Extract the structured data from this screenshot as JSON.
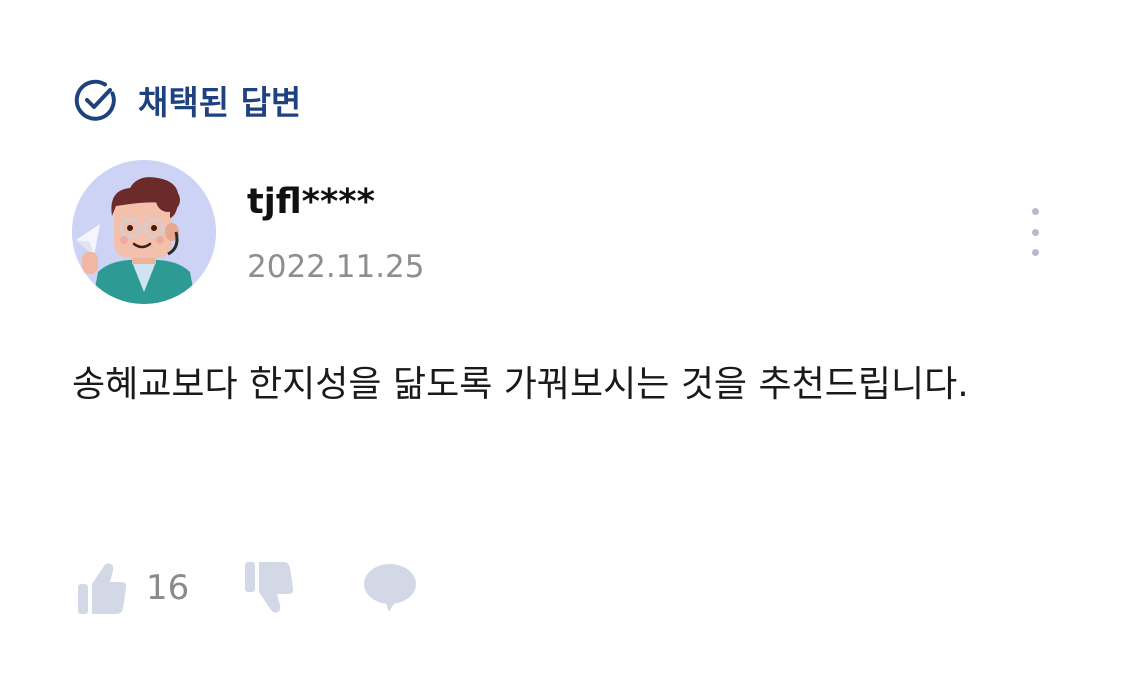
{
  "badge": {
    "label": "채택된 답변",
    "icon": "check-circle-icon",
    "color": "#1e4280"
  },
  "author": {
    "name": "tjfl****",
    "date": "2022.11.25",
    "avatar_icon": "character-avatar"
  },
  "answer": {
    "text": "송혜교보다 한지성을 닮도록 가꿔보시는 것을 추천드립니다."
  },
  "actions": {
    "like_icon": "thumbs-up-icon",
    "like_count": "16",
    "dislike_icon": "thumbs-down-icon",
    "comment_icon": "speech-bubble-icon",
    "more_icon": "vertical-ellipsis-icon",
    "icon_color": "#d3d8e6"
  }
}
